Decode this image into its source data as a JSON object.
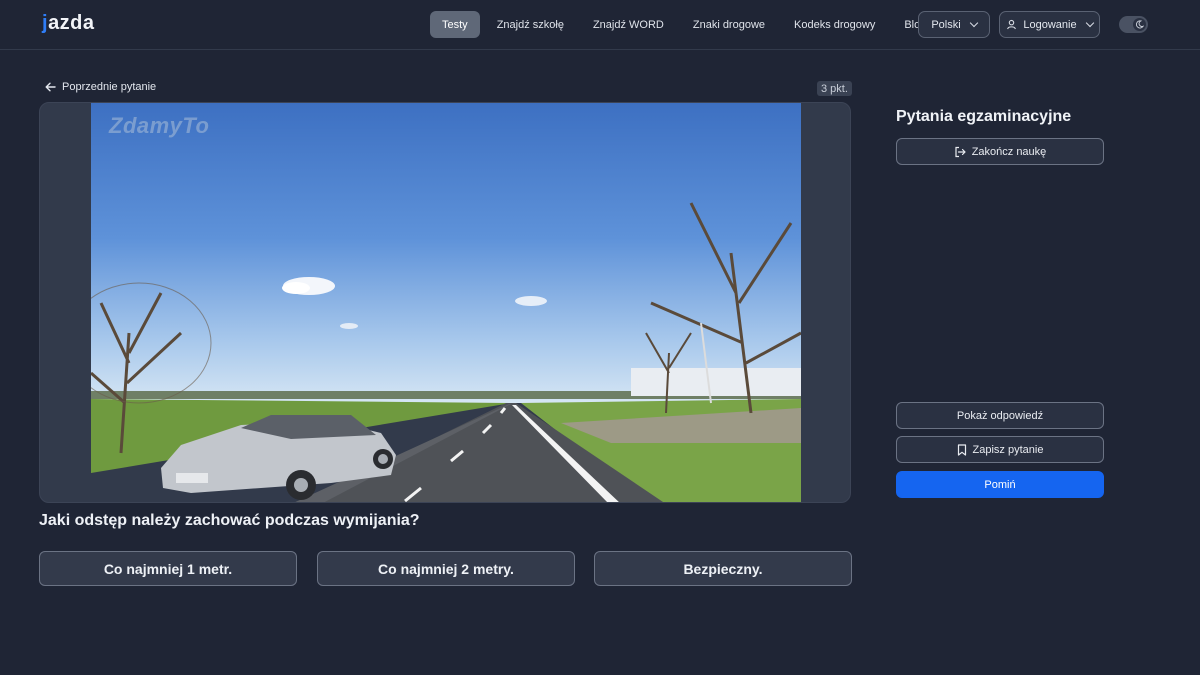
{
  "header": {
    "logo": "jazda",
    "nav": [
      {
        "label": "Testy",
        "active": true
      },
      {
        "label": "Znajdź szkołę",
        "active": false
      },
      {
        "label": "Znajdź WORD",
        "active": false
      },
      {
        "label": "Znaki drogowe",
        "active": false
      },
      {
        "label": "Kodeks drogowy",
        "active": false
      },
      {
        "label": "Blog",
        "active": false
      }
    ],
    "language": "Polski",
    "login": "Logowanie"
  },
  "question_panel": {
    "back_label": "Poprzednie pytanie",
    "points": "3 pkt.",
    "watermark": "ZdamyTo",
    "question": "Jaki odstęp należy zachować podczas wymijania?",
    "answers": [
      "Co najmniej 1 metr.",
      "Co najmniej 2 metry.",
      "Bezpieczny."
    ]
  },
  "sidebar": {
    "title": "Pytania egzaminacyjne",
    "finish_label": "Zakończ naukę",
    "show_answer_label": "Pokaż odpowiedź",
    "save_label": "Zapisz pytanie",
    "skip_label": "Pomiń"
  },
  "colors": {
    "background": "#1f2535",
    "accent": "#1565f0"
  }
}
